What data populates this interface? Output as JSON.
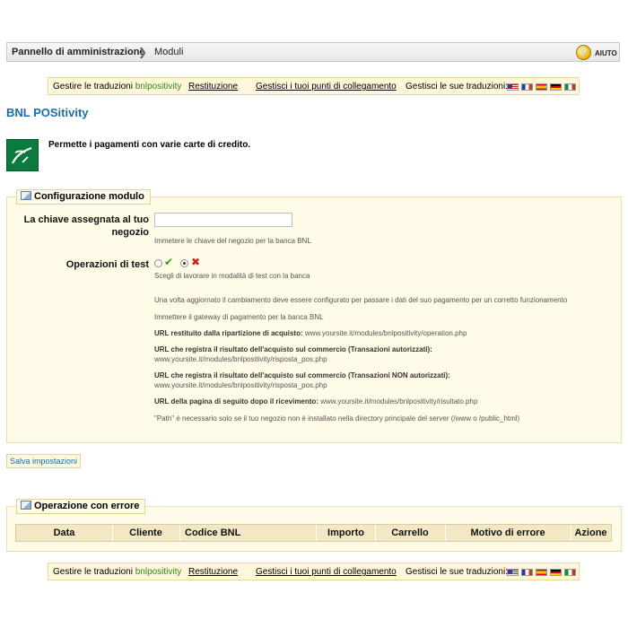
{
  "breadcrumb": {
    "root": "Pannello di amministrazione",
    "separator": ">",
    "current": "Moduli"
  },
  "help": {
    "label": "AIUTO",
    "icon": "help-question-icon"
  },
  "translations": {
    "manage_label": "Gestire le traduzioni",
    "module_name": "bnlpositivity",
    "restituzione": "Restituzione",
    "hooks": "Gestisci i tuoi punti di collegamento",
    "translations_label": "Gestisci le sue traduzioni:",
    "flags": [
      "flag-us-icon",
      "flag-fr-icon",
      "flag-es-icon",
      "flag-de-icon",
      "flag-it-icon"
    ]
  },
  "page": {
    "title": "BNL POSitivity",
    "description": "Permette i pagamenti con varie carte di credito."
  },
  "config": {
    "legend": "Configurazione modulo",
    "key_label_1": "La chiave assegnata al tuo",
    "key_label_2": "negozio",
    "key_value": "",
    "key_hint": "Immetere le chiave del negozio per la banca BNL",
    "test_label": "Operazioni di test",
    "test_hint": "Scegli di lavorare in modalità di test con la banca",
    "info_1": "Una volta aggiornato il cambiamento deve essere configurato per passare i dati del suo pagamento per un corretto funzionamento",
    "info_2": "Immettere il gateway di pagamento per la banca BNL",
    "url1_label": "URL restituito dalla ripartizione di acquisto:",
    "url1_value": "www.yoursite.it/modules/bnlpositivity/operation.php",
    "url2_label": "URL che registra il risultato dell'acquisto sul commercio (Transazioni autorizzati):",
    "url2_value": "www.yoursite.it/modules/bnlpositivity/risposta_pos.php",
    "url3_label": "URL che registra il risultato dell'acquisto sul commercio (Transazioni NON autorizzati):",
    "url3_value": "www.yoursite.it/modules/bnlpositivity/risposta_pos.php",
    "url4_label": "URL della pagina di seguito dopo il ricevimento:",
    "url4_value": "www.yoursite.it/modules/bnlpositivity/risultato.php",
    "path_note": "\"Path\" è necessario solo se il tuo negozio non è installato nella directory principale del server (/www o /public_html)"
  },
  "save_label": "Salva impostazioni",
  "errors": {
    "legend": "Operazione con errore",
    "columns": [
      "Data",
      "Cliente",
      "Codice BNL",
      "Importo",
      "Carrello",
      "Motivo di errore",
      "Azione"
    ]
  }
}
